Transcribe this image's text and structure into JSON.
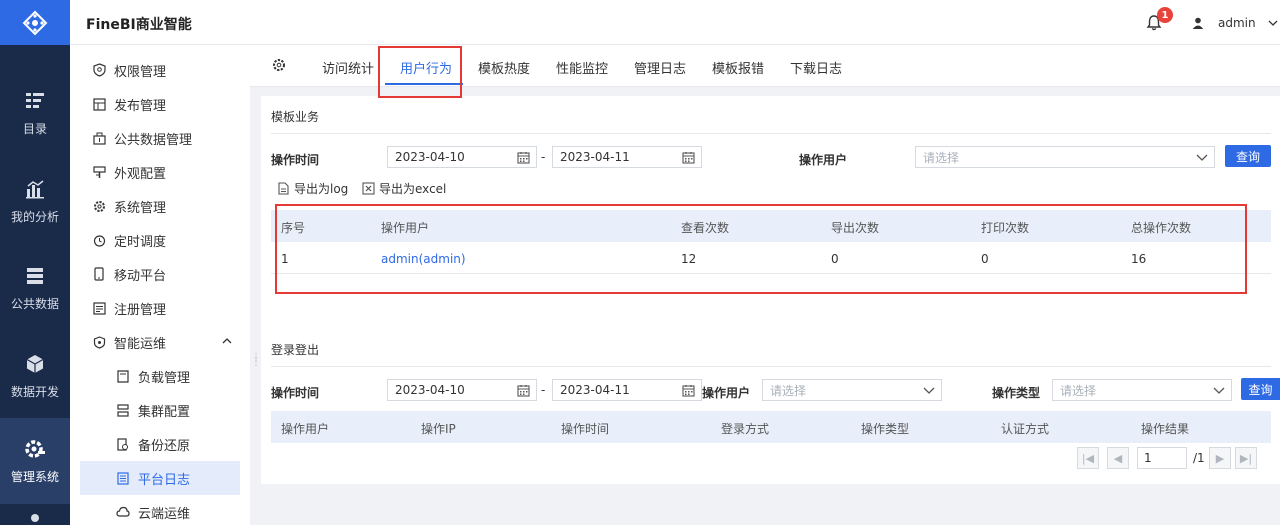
{
  "app": {
    "title": "FineBI商业智能"
  },
  "header": {
    "notification_count": "1",
    "user_name": "admin"
  },
  "rail": {
    "items": [
      {
        "label": "目录",
        "icon": "catalog-icon"
      },
      {
        "label": "我的分析",
        "icon": "analysis-icon"
      },
      {
        "label": "公共数据",
        "icon": "public-data-icon"
      },
      {
        "label": "数据开发",
        "icon": "data-dev-icon"
      },
      {
        "label": "管理系统",
        "icon": "manage-system-icon",
        "active": true
      }
    ]
  },
  "menu": {
    "items": [
      {
        "label": "权限管理",
        "icon": "shield-icon"
      },
      {
        "label": "发布管理",
        "icon": "publish-icon"
      },
      {
        "label": "公共数据管理",
        "icon": "public-data-manage-icon"
      },
      {
        "label": "外观配置",
        "icon": "appearance-icon"
      },
      {
        "label": "系统管理",
        "icon": "gear-icon"
      },
      {
        "label": "定时调度",
        "icon": "clock-icon"
      },
      {
        "label": "移动平台",
        "icon": "mobile-icon"
      },
      {
        "label": "注册管理",
        "icon": "register-icon"
      },
      {
        "label": "智能运维",
        "icon": "ops-icon",
        "expanded": true
      },
      {
        "label": "负载管理",
        "icon": "load-icon",
        "sub": true
      },
      {
        "label": "集群配置",
        "icon": "cluster-icon",
        "sub": true
      },
      {
        "label": "备份还原",
        "icon": "backup-icon",
        "sub": true
      },
      {
        "label": "平台日志",
        "icon": "log-icon",
        "sub": true,
        "active": true
      },
      {
        "label": "云端运维",
        "icon": "cloud-icon",
        "sub": true
      }
    ]
  },
  "tabs": {
    "items": [
      "访问统计",
      "用户行为",
      "模板热度",
      "性能监控",
      "管理日志",
      "模板报错",
      "下载日志"
    ],
    "active": "用户行为"
  },
  "template_section": {
    "title": "模板业务",
    "op_time_label": "操作时间",
    "start_date": "2023-04-10",
    "end_date": "2023-04-11",
    "range_sep": "-",
    "op_user_label": "操作用户",
    "op_user_placeholder": "请选择",
    "query_label": "查询",
    "export_log": "导出为log",
    "export_excel": "导出为excel",
    "table": {
      "headers": [
        "序号",
        "操作用户",
        "查看次数",
        "导出次数",
        "打印次数",
        "总操作次数"
      ],
      "rows": [
        [
          "1",
          "admin(admin)",
          "12",
          "0",
          "0",
          "16"
        ]
      ]
    }
  },
  "login_section": {
    "title": "登录登出",
    "op_time_label": "操作时间",
    "start_date": "2023-04-10",
    "end_date": "2023-04-11",
    "range_sep": "-",
    "op_user_label": "操作用户",
    "op_user_placeholder": "请选择",
    "op_type_label": "操作类型",
    "op_type_placeholder": "请选择",
    "query_label": "查询",
    "table": {
      "headers": [
        "操作用户",
        "操作IP",
        "操作时间",
        "登录方式",
        "操作类型",
        "认证方式",
        "操作结果"
      ]
    },
    "pager": {
      "page": "1",
      "total": "/1"
    }
  },
  "colors": {
    "accent": "#2f6ae5",
    "rail_bg": "#1a2b4a",
    "highlight_red": "#e53935"
  }
}
